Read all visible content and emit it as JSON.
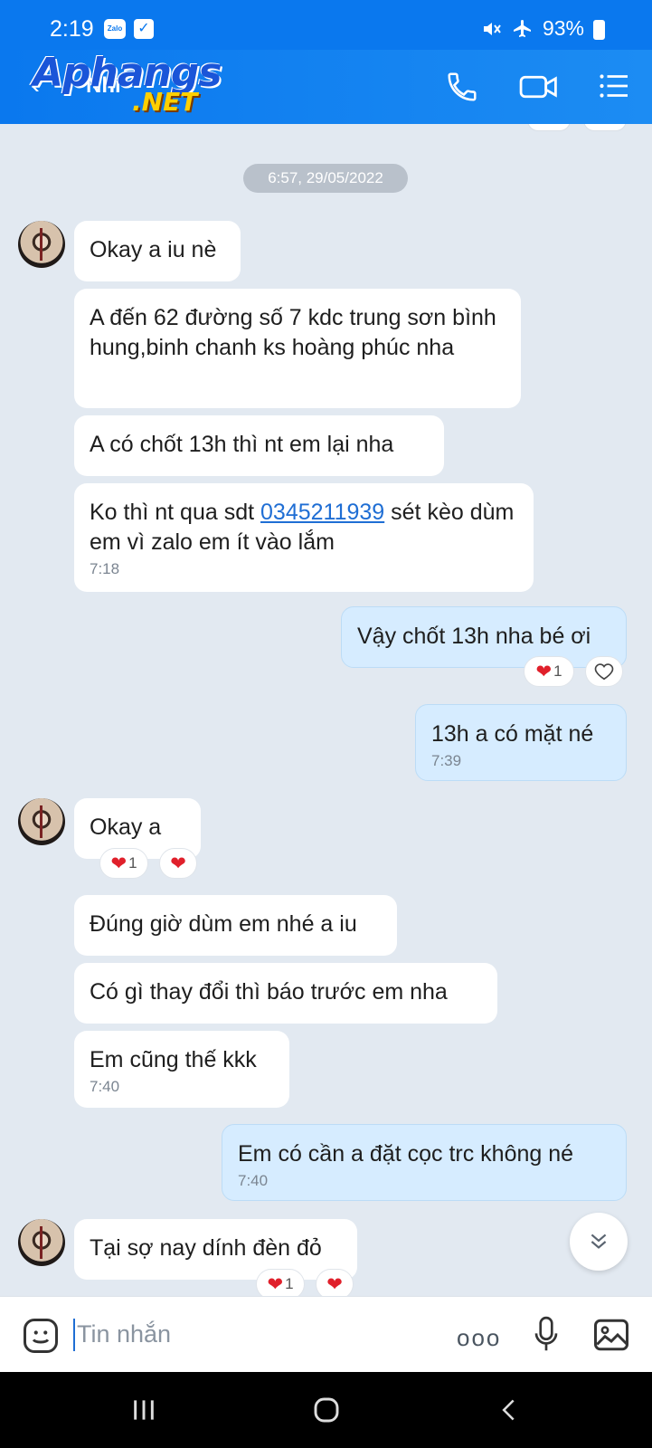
{
  "status_bar": {
    "time": "2:19",
    "zalo_badge": "Zalo",
    "battery": "93%"
  },
  "header": {
    "contact_name": "Nhí",
    "watermark_line1": "Aphangs",
    "watermark_line2": ".NET",
    "icons": [
      "back-arrow-icon",
      "phone-icon",
      "video-icon",
      "menu-list-icon"
    ]
  },
  "chat": {
    "date_separator": "6:57, 29/05/2022",
    "messages": [
      {
        "side": "in",
        "text": "Okay a iu nè"
      },
      {
        "side": "in",
        "text": "A đến 62 đường số 7 kdc trung sơn bình hung,binh chanh ks hoàng phúc nha"
      },
      {
        "side": "in",
        "text": "A có chốt 13h thì nt em lại nha"
      },
      {
        "side": "in",
        "text_before": "Ko thì nt qua sdt ",
        "phone": "0345211939",
        "text_after": " sét kèo dùm em vì zalo em ít vào lắm",
        "time": "7:18"
      },
      {
        "side": "out",
        "text": "Vậy chốt 13h nha bé ơi",
        "reaction_count": "1"
      },
      {
        "side": "out",
        "text": "13h a có mặt né",
        "time": "7:39"
      },
      {
        "side": "in",
        "text": "Okay a",
        "reaction_count": "1"
      },
      {
        "side": "in",
        "text": "Đúng giờ dùm em nhé a iu"
      },
      {
        "side": "in",
        "text": "Có gì thay đổi thì báo trước em nha"
      },
      {
        "side": "in",
        "text": "Em cũng thế kkk",
        "time": "7:40"
      },
      {
        "side": "out",
        "text": "Em có cần a đặt cọc trc không né",
        "time": "7:40"
      },
      {
        "side": "in",
        "text": "Tại sợ nay dính đèn đỏ",
        "reaction_count": "1"
      }
    ]
  },
  "input_bar": {
    "placeholder": "Tin nhắn",
    "more_label": "ooo"
  },
  "colors": {
    "header_blue": "#0a78ee",
    "chat_bg": "#e2e9f1",
    "outgoing_bubble": "#d6ecff",
    "heart_red": "#e0202b",
    "link_blue": "#1f6ed4"
  }
}
